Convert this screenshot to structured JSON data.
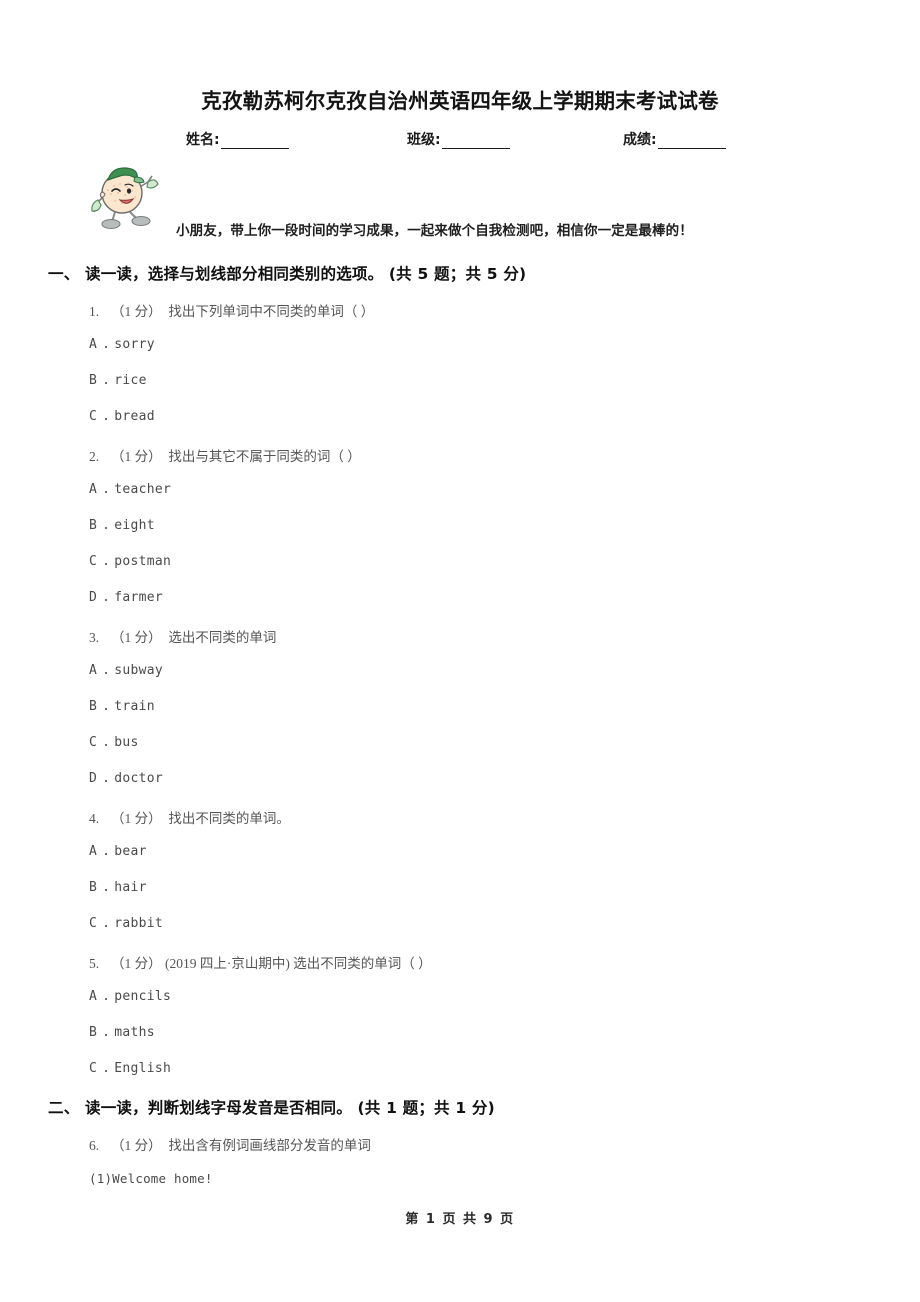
{
  "document": {
    "title": "克孜勒苏柯尔克孜自治州英语四年级上学期期末考试试卷",
    "encouragement": "小朋友，带上你一段时间的学习成果，一起来做个自我检测吧，相信你一定是最棒的！",
    "footer": "第 1 页 共 9 页"
  },
  "identity": {
    "name_label": "姓名:",
    "class_label": "班级:",
    "score_label": "成绩:"
  },
  "sections": [
    {
      "heading": "一、 读一读，选择与划线部分相同类别的选项。 (共 5 题；共 5 分)",
      "questions": [
        {
          "number": "1.",
          "points": "（1 分）",
          "tag": "",
          "text": "找出下列单词中不同类的单词（      ）",
          "options": [
            {
              "letter": "A",
              "sep": ".",
              "text": "sorry"
            },
            {
              "letter": "B",
              "sep": ".",
              "text": "rice"
            },
            {
              "letter": "C",
              "sep": ".",
              "text": "bread"
            }
          ]
        },
        {
          "number": "2.",
          "points": "（1 分）",
          "tag": "",
          "text": "找出与其它不属于同类的词（      ）",
          "options": [
            {
              "letter": "A",
              "sep": ".",
              "text": "teacher"
            },
            {
              "letter": "B",
              "sep": ".",
              "text": "eight"
            },
            {
              "letter": "C",
              "sep": ".",
              "text": "postman"
            },
            {
              "letter": "D",
              "sep": ".",
              "text": "farmer"
            }
          ]
        },
        {
          "number": "3.",
          "points": "（1 分）",
          "tag": "",
          "text": "   选出不同类的单词",
          "options": [
            {
              "letter": "A",
              "sep": ".",
              "text": "subway"
            },
            {
              "letter": "B",
              "sep": ".",
              "text": "train"
            },
            {
              "letter": "C",
              "sep": ".",
              "text": "bus"
            },
            {
              "letter": "D",
              "sep": ".",
              "text": "doctor"
            }
          ]
        },
        {
          "number": "4.",
          "points": "（1 分）",
          "tag": "",
          "text": "找出不同类的单词。",
          "options": [
            {
              "letter": "A",
              "sep": ".",
              "text": "bear"
            },
            {
              "letter": "B",
              "sep": ".",
              "text": "hair"
            },
            {
              "letter": "C",
              "sep": ".",
              "text": "rabbit"
            }
          ]
        },
        {
          "number": "5.",
          "points": "（1 分）",
          "tag": "(2019 四上·京山期中)",
          "text": "选出不同类的单词（      ）",
          "options": [
            {
              "letter": "A",
              "sep": ".",
              "text": "pencils"
            },
            {
              "letter": "B",
              "sep": ".",
              "text": "maths"
            },
            {
              "letter": "C",
              "sep": ".",
              "text": "English"
            }
          ]
        }
      ]
    },
    {
      "heading": "二、 读一读，判断划线字母发音是否相同。 (共 1 题；共 1 分)",
      "questions": [
        {
          "number": "6.",
          "points": "（1 分）",
          "tag": "",
          "text": "找出含有例词画线部分发音的单词",
          "subitems": [
            {
              "text": "(1)Welcome home!"
            }
          ],
          "options": []
        }
      ]
    }
  ]
}
